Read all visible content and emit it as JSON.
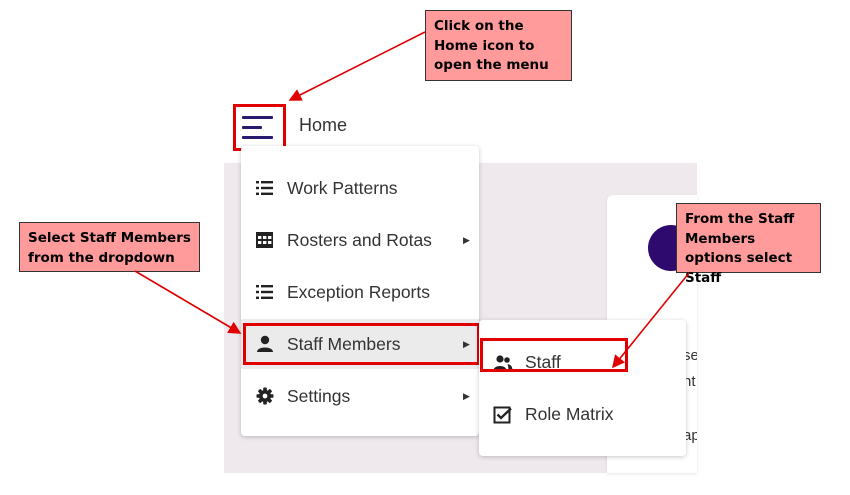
{
  "header": {
    "menu_icon": "hamburger-menu-icon",
    "home_label": "Home"
  },
  "menu": {
    "items": [
      {
        "label": "Work Patterns",
        "icon": "list-icon",
        "has_submenu": false
      },
      {
        "label": "Rosters and Rotas",
        "icon": "calendar-grid-icon",
        "has_submenu": true
      },
      {
        "label": "Exception Reports",
        "icon": "list-icon",
        "has_submenu": false
      },
      {
        "label": "Staff Members",
        "icon": "person-icon",
        "has_submenu": true,
        "active": true
      },
      {
        "label": "Settings",
        "icon": "gear-icon",
        "has_submenu": true
      }
    ]
  },
  "submenu": {
    "items": [
      {
        "label": "Staff",
        "icon": "users-icon"
      },
      {
        "label": "Role Matrix",
        "icon": "checkbox-icon"
      }
    ]
  },
  "background": {
    "clipped_text": [
      "se",
      "nt",
      "ap"
    ]
  },
  "callouts": {
    "home": "Click on the Home icon to open the menu",
    "staff_members": "Select Staff Members from the dropdown",
    "staff": "From the Staff Members options select Staff"
  },
  "colors": {
    "highlight_border": "#e00000",
    "callout_fill": "#ff9b9b",
    "brand_dark": "#2a1a6e",
    "background_panel": "#efe9ee"
  }
}
